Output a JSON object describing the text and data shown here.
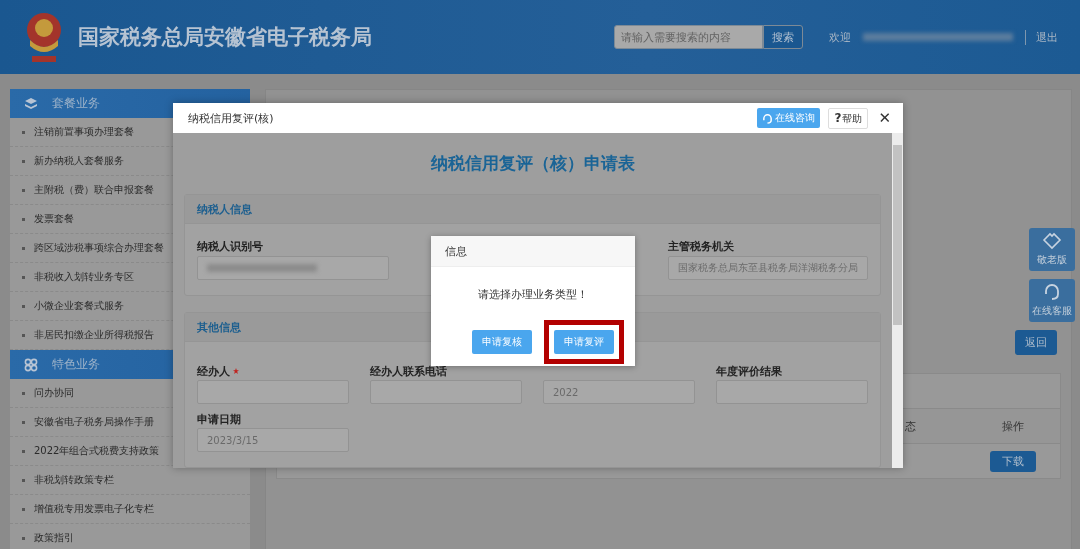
{
  "header": {
    "title": "国家税务总局安徽省电子税务局",
    "search": {
      "placeholder": "请输入需要搜索的内容",
      "button": "搜索"
    },
    "welcome": "欢迎",
    "logout": "退出"
  },
  "sidebar": {
    "sections": [
      {
        "title": "套餐业务",
        "items": [
          "注销前置事项办理套餐",
          "新办纳税人套餐服务",
          "主附税（费）联合申报套餐",
          "发票套餐",
          "跨区域涉税事项综合办理套餐",
          "非税收入划转业务专区",
          "小微企业套餐式服务",
          "非居民扣缴企业所得税报告"
        ]
      },
      {
        "title": "特色业务",
        "items": [
          "问办协同",
          "安徽省电子税务局操作手册",
          "2022年组合式税费支持政策",
          "非税划转政策专栏",
          "增值税专用发票电子化专栏",
          "政策指引"
        ]
      }
    ]
  },
  "side_buttons": [
    {
      "label": "敬老版"
    },
    {
      "label": "在线客服"
    }
  ],
  "main": {
    "back_button": "返回",
    "table": {
      "columns": [
        "态",
        "操作"
      ],
      "rows": [
        {
          "action": "下载"
        }
      ]
    }
  },
  "modal": {
    "title": "纳税信用复评(核)",
    "consult_button": "在线咨询",
    "help_glyph": "?",
    "help_button": "帮助",
    "close_glyph": "✕",
    "form_title": "纳税信用复评（核）申请表",
    "sections": [
      {
        "title": "纳税人信息",
        "fields": [
          {
            "label": "纳税人识别号",
            "redacted": true
          },
          {
            "label": "主管税务机关",
            "value": "国家税务总局东至县税务局洋湖税务分局"
          }
        ]
      },
      {
        "title": "其他信息",
        "fields": [
          {
            "label": "经办人",
            "required": true
          },
          {
            "label": "经办人联系电话"
          },
          {
            "value": "2022"
          },
          {
            "label": "年度评价结果"
          },
          {
            "label": "申请日期",
            "value": "2023/3/15"
          }
        ]
      }
    ]
  },
  "info_dialog": {
    "title": "信息",
    "message": "请选择办理业务类型！",
    "buttons": [
      {
        "label": "申请复核",
        "highlighted": false
      },
      {
        "label": "申请复评",
        "highlighted": true
      }
    ]
  }
}
